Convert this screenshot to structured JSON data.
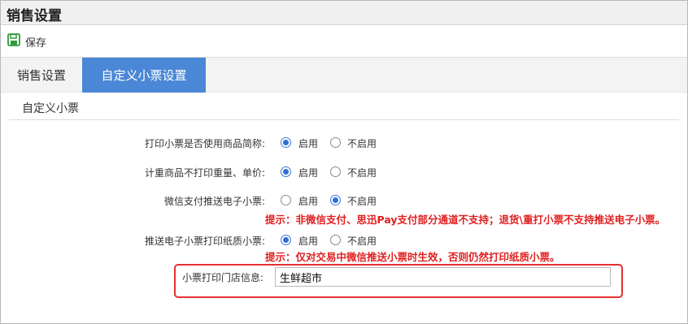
{
  "window": {
    "title": "销售设置"
  },
  "toolbar": {
    "save_label": "保存"
  },
  "tabs": [
    {
      "label": "销售设置",
      "active": false
    },
    {
      "label": "自定义小票设置",
      "active": true
    }
  ],
  "section": {
    "title": "自定义小票"
  },
  "settings": [
    {
      "label": "打印小票是否使用商品简称:",
      "options": [
        "启用",
        "不启用"
      ],
      "selected": "启用"
    },
    {
      "label": "计重商品不打印重量、单价:",
      "options": [
        "启用",
        "不启用"
      ],
      "selected": "启用"
    },
    {
      "label": "微信支付推送电子小票:",
      "options": [
        "启用",
        "不启用"
      ],
      "selected": "不启用",
      "hint": "提示：非微信支付、思迅Pay支付部分通道不支持；退货\\重打小票不支持推送电子小票。"
    },
    {
      "label": "推送电子小票打印纸质小票:",
      "options": [
        "启用",
        "不启用"
      ],
      "selected": "启用",
      "hint": "提示：仅对交易中微信推送小票时生效，否则仍然打印纸质小票。"
    }
  ],
  "store_info": {
    "label": "小票打印门店信息:",
    "value": "生鲜超市"
  },
  "colors": {
    "accent": "#4a87d6",
    "hint": "#e02020",
    "save_icon": "#2e9a3a"
  }
}
